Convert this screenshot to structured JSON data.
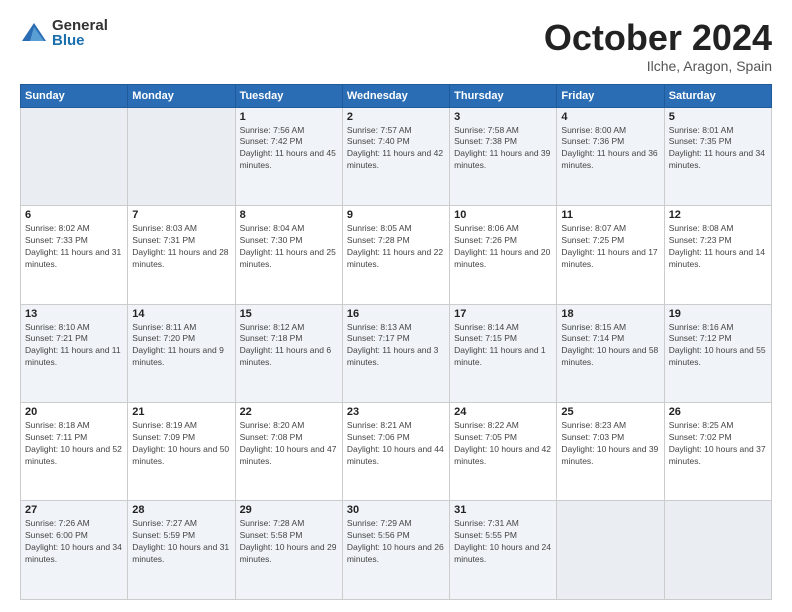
{
  "logo": {
    "general": "General",
    "blue": "Blue"
  },
  "title": {
    "month": "October 2024",
    "location": "Ilche, Aragon, Spain"
  },
  "weekdays": [
    "Sunday",
    "Monday",
    "Tuesday",
    "Wednesday",
    "Thursday",
    "Friday",
    "Saturday"
  ],
  "weeks": [
    [
      {
        "day": "",
        "detail": ""
      },
      {
        "day": "",
        "detail": ""
      },
      {
        "day": "1",
        "detail": "Sunrise: 7:56 AM\nSunset: 7:42 PM\nDaylight: 11 hours and 45 minutes."
      },
      {
        "day": "2",
        "detail": "Sunrise: 7:57 AM\nSunset: 7:40 PM\nDaylight: 11 hours and 42 minutes."
      },
      {
        "day": "3",
        "detail": "Sunrise: 7:58 AM\nSunset: 7:38 PM\nDaylight: 11 hours and 39 minutes."
      },
      {
        "day": "4",
        "detail": "Sunrise: 8:00 AM\nSunset: 7:36 PM\nDaylight: 11 hours and 36 minutes."
      },
      {
        "day": "5",
        "detail": "Sunrise: 8:01 AM\nSunset: 7:35 PM\nDaylight: 11 hours and 34 minutes."
      }
    ],
    [
      {
        "day": "6",
        "detail": "Sunrise: 8:02 AM\nSunset: 7:33 PM\nDaylight: 11 hours and 31 minutes."
      },
      {
        "day": "7",
        "detail": "Sunrise: 8:03 AM\nSunset: 7:31 PM\nDaylight: 11 hours and 28 minutes."
      },
      {
        "day": "8",
        "detail": "Sunrise: 8:04 AM\nSunset: 7:30 PM\nDaylight: 11 hours and 25 minutes."
      },
      {
        "day": "9",
        "detail": "Sunrise: 8:05 AM\nSunset: 7:28 PM\nDaylight: 11 hours and 22 minutes."
      },
      {
        "day": "10",
        "detail": "Sunrise: 8:06 AM\nSunset: 7:26 PM\nDaylight: 11 hours and 20 minutes."
      },
      {
        "day": "11",
        "detail": "Sunrise: 8:07 AM\nSunset: 7:25 PM\nDaylight: 11 hours and 17 minutes."
      },
      {
        "day": "12",
        "detail": "Sunrise: 8:08 AM\nSunset: 7:23 PM\nDaylight: 11 hours and 14 minutes."
      }
    ],
    [
      {
        "day": "13",
        "detail": "Sunrise: 8:10 AM\nSunset: 7:21 PM\nDaylight: 11 hours and 11 minutes."
      },
      {
        "day": "14",
        "detail": "Sunrise: 8:11 AM\nSunset: 7:20 PM\nDaylight: 11 hours and 9 minutes."
      },
      {
        "day": "15",
        "detail": "Sunrise: 8:12 AM\nSunset: 7:18 PM\nDaylight: 11 hours and 6 minutes."
      },
      {
        "day": "16",
        "detail": "Sunrise: 8:13 AM\nSunset: 7:17 PM\nDaylight: 11 hours and 3 minutes."
      },
      {
        "day": "17",
        "detail": "Sunrise: 8:14 AM\nSunset: 7:15 PM\nDaylight: 11 hours and 1 minute."
      },
      {
        "day": "18",
        "detail": "Sunrise: 8:15 AM\nSunset: 7:14 PM\nDaylight: 10 hours and 58 minutes."
      },
      {
        "day": "19",
        "detail": "Sunrise: 8:16 AM\nSunset: 7:12 PM\nDaylight: 10 hours and 55 minutes."
      }
    ],
    [
      {
        "day": "20",
        "detail": "Sunrise: 8:18 AM\nSunset: 7:11 PM\nDaylight: 10 hours and 52 minutes."
      },
      {
        "day": "21",
        "detail": "Sunrise: 8:19 AM\nSunset: 7:09 PM\nDaylight: 10 hours and 50 minutes."
      },
      {
        "day": "22",
        "detail": "Sunrise: 8:20 AM\nSunset: 7:08 PM\nDaylight: 10 hours and 47 minutes."
      },
      {
        "day": "23",
        "detail": "Sunrise: 8:21 AM\nSunset: 7:06 PM\nDaylight: 10 hours and 44 minutes."
      },
      {
        "day": "24",
        "detail": "Sunrise: 8:22 AM\nSunset: 7:05 PM\nDaylight: 10 hours and 42 minutes."
      },
      {
        "day": "25",
        "detail": "Sunrise: 8:23 AM\nSunset: 7:03 PM\nDaylight: 10 hours and 39 minutes."
      },
      {
        "day": "26",
        "detail": "Sunrise: 8:25 AM\nSunset: 7:02 PM\nDaylight: 10 hours and 37 minutes."
      }
    ],
    [
      {
        "day": "27",
        "detail": "Sunrise: 7:26 AM\nSunset: 6:00 PM\nDaylight: 10 hours and 34 minutes."
      },
      {
        "day": "28",
        "detail": "Sunrise: 7:27 AM\nSunset: 5:59 PM\nDaylight: 10 hours and 31 minutes."
      },
      {
        "day": "29",
        "detail": "Sunrise: 7:28 AM\nSunset: 5:58 PM\nDaylight: 10 hours and 29 minutes."
      },
      {
        "day": "30",
        "detail": "Sunrise: 7:29 AM\nSunset: 5:56 PM\nDaylight: 10 hours and 26 minutes."
      },
      {
        "day": "31",
        "detail": "Sunrise: 7:31 AM\nSunset: 5:55 PM\nDaylight: 10 hours and 24 minutes."
      },
      {
        "day": "",
        "detail": ""
      },
      {
        "day": "",
        "detail": ""
      }
    ]
  ]
}
